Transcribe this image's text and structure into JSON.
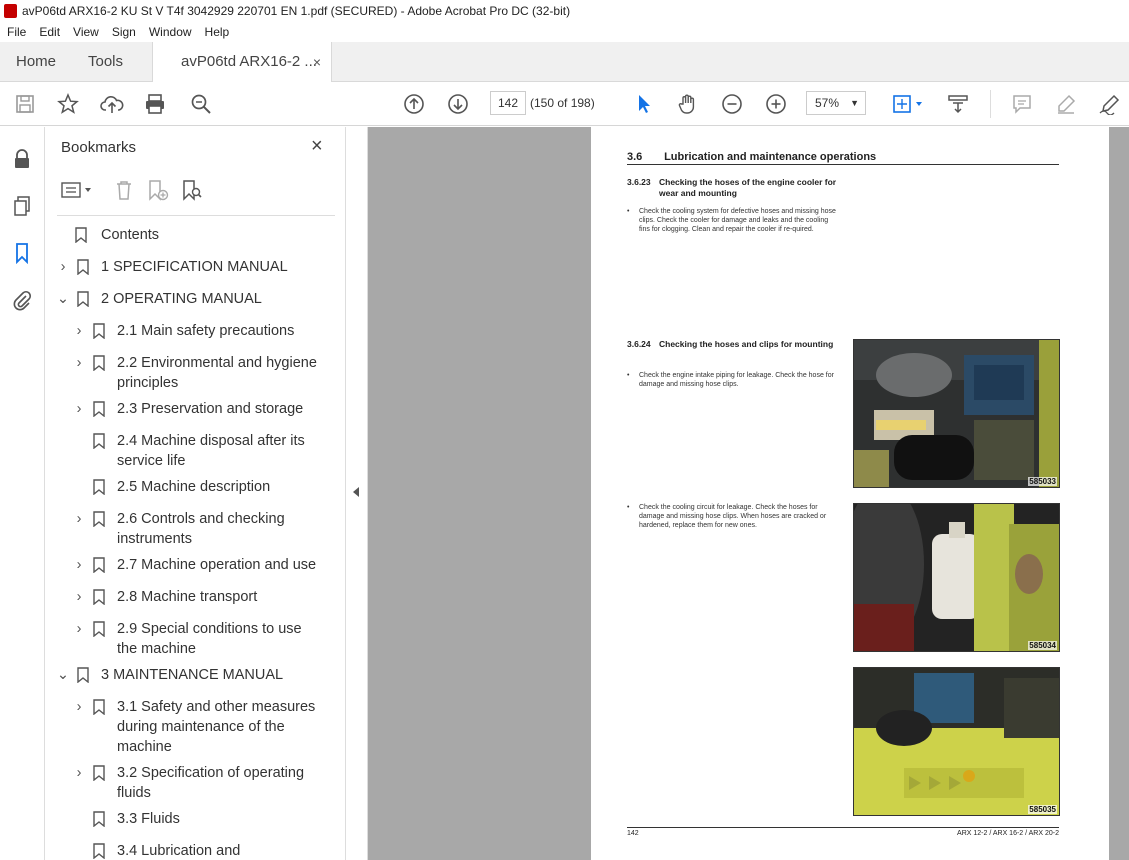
{
  "window": {
    "title": "avP06td ARX16-2 KU St V T4f 3042929 220701 EN 1.pdf (SECURED) - Adobe Acrobat Pro DC (32-bit)"
  },
  "menu": [
    "File",
    "Edit",
    "View",
    "Sign",
    "Window",
    "Help"
  ],
  "tabs": {
    "home": "Home",
    "tools": "Tools",
    "doc": "avP06td ARX16-2 ...",
    "close": "×"
  },
  "toolbar": {
    "page_current": "142",
    "page_count": "(150 of 198)",
    "zoom": "57%"
  },
  "bookmarks": {
    "title": "Bookmarks",
    "close": "×",
    "items": [
      {
        "label": "Contents"
      },
      {
        "label": "1 SPECIFICATION MANUAL"
      },
      {
        "label": "2 OPERATING MANUAL"
      },
      {
        "label": "2.1 Main safety precautions"
      },
      {
        "label": "2.2 Environmental and hygiene principles"
      },
      {
        "label": "2.3 Preservation and storage"
      },
      {
        "label": "2.4 Machine disposal after its service life"
      },
      {
        "label": "2.5 Machine description"
      },
      {
        "label": "2.6 Controls and checking instruments"
      },
      {
        "label": "2.7 Machine operation and use"
      },
      {
        "label": "2.8 Machine transport"
      },
      {
        "label": "2.9 Special conditions to use the machine"
      },
      {
        "label": "3 MAINTENANCE MANUAL"
      },
      {
        "label": "3.1 Safety and other measures during maintenance of the machine"
      },
      {
        "label": "3.2 Specification of operating fluids"
      },
      {
        "label": "3.3 Fluids"
      },
      {
        "label": "3.4 Lubrication and"
      }
    ]
  },
  "document": {
    "section_num": "3.6",
    "section_title": "Lubrication and maintenance operations",
    "sub1_num": "3.6.23",
    "sub1_title": "Checking the hoses of the engine cooler for wear and mounting",
    "sub1_text": "Check the cooling system for defective hoses and missing hose clips. Check the cooler for damage and leaks and the cooling fins for clogging. Clean and repair the cooler if re-quired.",
    "sub2_num": "3.6.24",
    "sub2_title": "Checking the hoses and clips for mounting",
    "sub2_text": "Check the engine intake piping for leakage. Check the hose for damage and missing hose clips.",
    "sub3_text": "Check the cooling circuit for leakage. Check the hoses for damage and missing hose clips. When hoses are cracked or hardened, replace them for new ones.",
    "bullet": "•",
    "photo1": "585033",
    "photo2": "585034",
    "photo3": "585035",
    "footer_page": "142",
    "footer_model": "ARX 12-2 / ARX 16-2 / ARX 20-2"
  }
}
